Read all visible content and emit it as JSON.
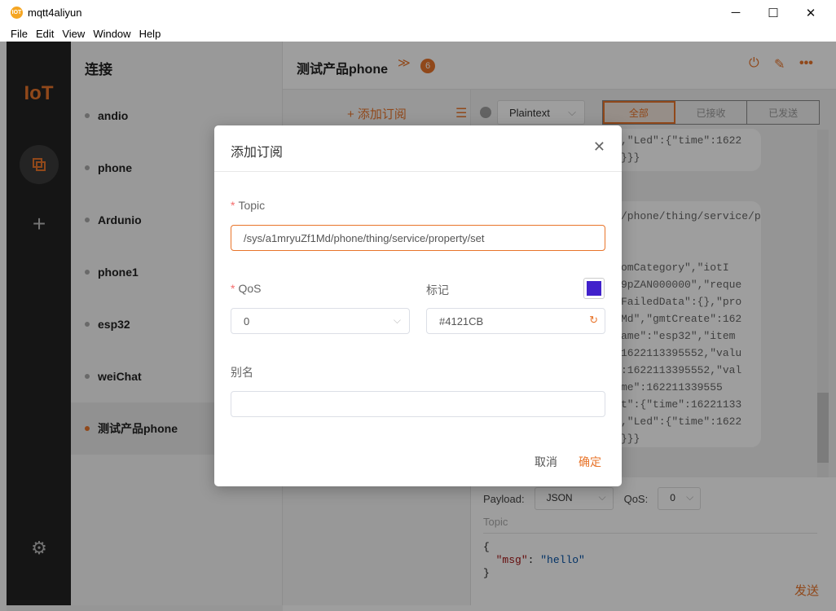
{
  "window": {
    "icon_text": "IOT",
    "title": "mqtt4aliyun",
    "minimize": "─",
    "maximize": "☐",
    "close": "✕"
  },
  "menu": [
    "File",
    "Edit",
    "View",
    "Window",
    "Help"
  ],
  "nav": {
    "logo": "IoT",
    "plus": "+",
    "gear": "⚙",
    "copy_icon": "copy-icon"
  },
  "connections": {
    "title": "连接",
    "items": [
      {
        "label": "andio",
        "active": false
      },
      {
        "label": "phone",
        "active": false
      },
      {
        "label": "Ardunio",
        "active": false
      },
      {
        "label": "phone1",
        "active": false
      },
      {
        "label": "esp32",
        "active": false
      },
      {
        "label": "weiChat",
        "active": false
      },
      {
        "label": "测试产品phone",
        "active": true
      }
    ]
  },
  "main": {
    "title": "测试产品phone",
    "chevron": "≫",
    "badge": "6",
    "power": "⏻",
    "edit": "✎",
    "more": "•••",
    "add_subscription": "+ 添加订阅",
    "list_icon": "☰",
    "format": "Plaintext",
    "format_caret": "⌵",
    "tabs": [
      {
        "label": "全部",
        "active": true
      },
      {
        "label": "已接收",
        "active": false
      },
      {
        "label": "已发送",
        "active": false
      }
    ],
    "bubble1": ",\"Led\":{\"time\":1622\n}}}",
    "bubble2": "/phone/thing/service/prop\n\n\nomCategory\",\"iotI\n9pZAN000000\",\"reque\nFailedData\":{},\"pro\nMd\",\"gmtCreate\":162\name\":\"esp32\",\"item\n1622113395552,\"valu\n:1622113395552,\"val\nme\":162211339555\nt\":{\"time\":16221133\n,\"Led\":{\"time\":1622\n}}}",
    "publish": {
      "payload_label": "Payload:",
      "payload_value": "JSON",
      "qos_label": "QoS:",
      "qos_value": "0",
      "topic_placeholder": "Topic",
      "code_open": "{",
      "code_key": "\"msg\"",
      "code_colon": ": ",
      "code_value": "\"hello\"",
      "code_close": "}",
      "send": "发送"
    }
  },
  "dialog": {
    "title": "添加订阅",
    "close": "✕",
    "topic_label": "Topic",
    "topic_value": "/sys/a1mryuZf1Md/phone/thing/service/property/set",
    "qos_label": "QoS",
    "qos_value": "0",
    "mark_label": "标记",
    "mark_value": "#4121CB",
    "mark_color": "#4121CB",
    "alias_label": "别名",
    "alias_value": "",
    "required_mark": "*",
    "cancel": "取消",
    "ok": "确定",
    "caret": "⌵",
    "refresh": "↻"
  }
}
